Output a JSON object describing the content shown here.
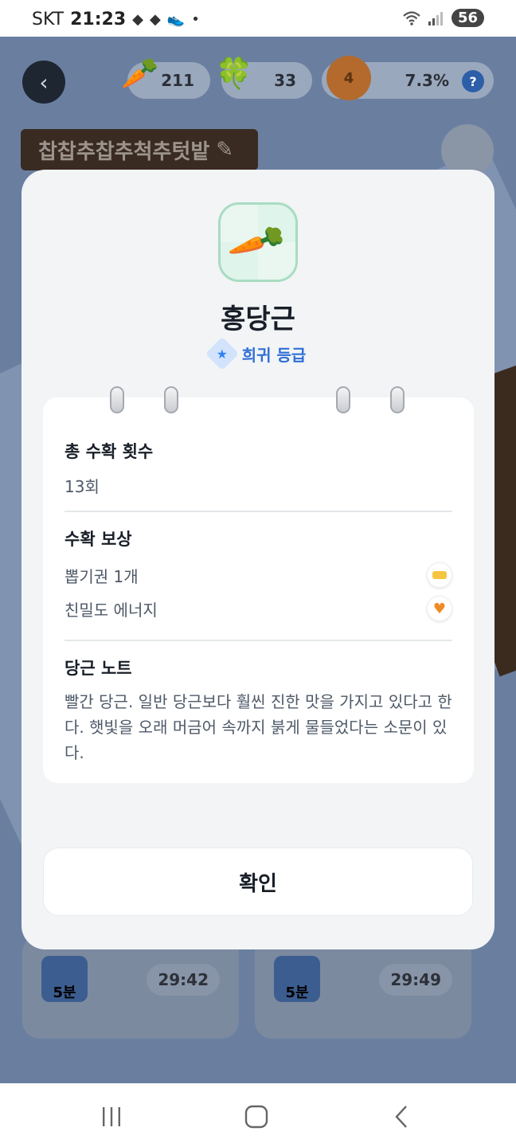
{
  "status_bar": {
    "carrier": "SKT",
    "time": "21:23",
    "battery": "56"
  },
  "game_hud": {
    "carrot_count": "211",
    "clover_count": "33",
    "heart_level": "4",
    "progress_percent": "7.3%",
    "help_label": "?",
    "field_name": "찹찹추찹추척추텃밭",
    "plots": [
      {
        "water_label": "5분",
        "timer": "29:42"
      },
      {
        "water_label": "5분",
        "timer": "29:49"
      }
    ]
  },
  "modal": {
    "title": "홍당근",
    "grade": "희귀 등급",
    "sections": {
      "harvest_count": {
        "title": "총 수확 횟수",
        "value": "13회"
      },
      "rewards": {
        "title": "수확 보상",
        "items": [
          {
            "label": "뽑기권 1개",
            "icon": "ticket-icon"
          },
          {
            "label": "친밀도 에너지",
            "icon": "heart-icon"
          }
        ]
      },
      "note": {
        "title": "당근 노트",
        "text": "빨간 당근. 일반 당근보다 훨씬 진한 맛을 가지고 있다고 한다. 햇빛을 오래 머금어 속까지 붉게 물들었다는 소문이 있다."
      }
    },
    "confirm_label": "확인"
  },
  "colors": {
    "accent_blue": "#3182f6",
    "modal_bg": "#f2f4f6",
    "icon_green": "#a9dcc2"
  }
}
